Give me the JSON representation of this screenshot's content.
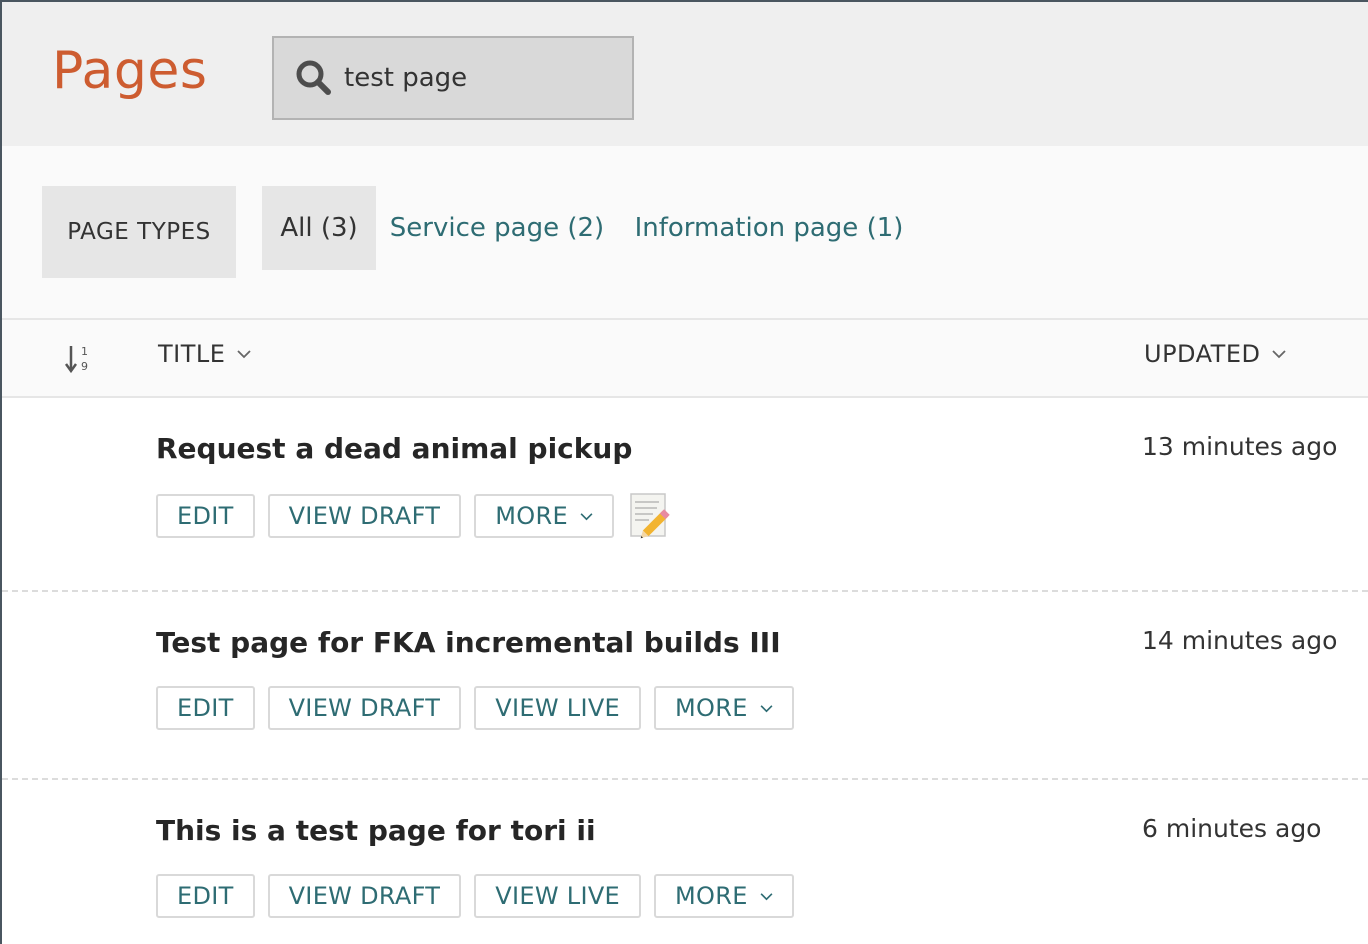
{
  "header": {
    "title": "Pages",
    "search": {
      "value": "test page",
      "placeholder": ""
    }
  },
  "filters": {
    "label": "PAGE TYPES",
    "tabs": [
      {
        "label": "All (3)",
        "active": true
      },
      {
        "label": "Service page (2)",
        "active": false
      },
      {
        "label": "Information page (1)",
        "active": false
      }
    ]
  },
  "table": {
    "columns": {
      "title": "TITLE",
      "updated": "UPDATED"
    },
    "rows": [
      {
        "title": "Request a dead animal pickup",
        "updated": "13 minutes ago",
        "actions": {
          "edit": "EDIT",
          "view_draft": "VIEW DRAFT",
          "more": "MORE"
        },
        "status_icon": "memo-icon"
      },
      {
        "title": "Test page for FKA incremental builds III",
        "updated": "14 minutes ago",
        "actions": {
          "edit": "EDIT",
          "view_draft": "VIEW DRAFT",
          "view_live": "VIEW LIVE",
          "more": "MORE"
        }
      },
      {
        "title": "This is a test page for tori ii",
        "updated": "6 minutes ago",
        "actions": {
          "edit": "EDIT",
          "view_draft": "VIEW DRAFT",
          "view_live": "VIEW LIVE",
          "more": "MORE"
        }
      }
    ]
  },
  "colors": {
    "title_accent": "#cd5c30",
    "link": "#2e6c73",
    "header_bg": "#efefef",
    "filter_bg": "#fafafa"
  }
}
